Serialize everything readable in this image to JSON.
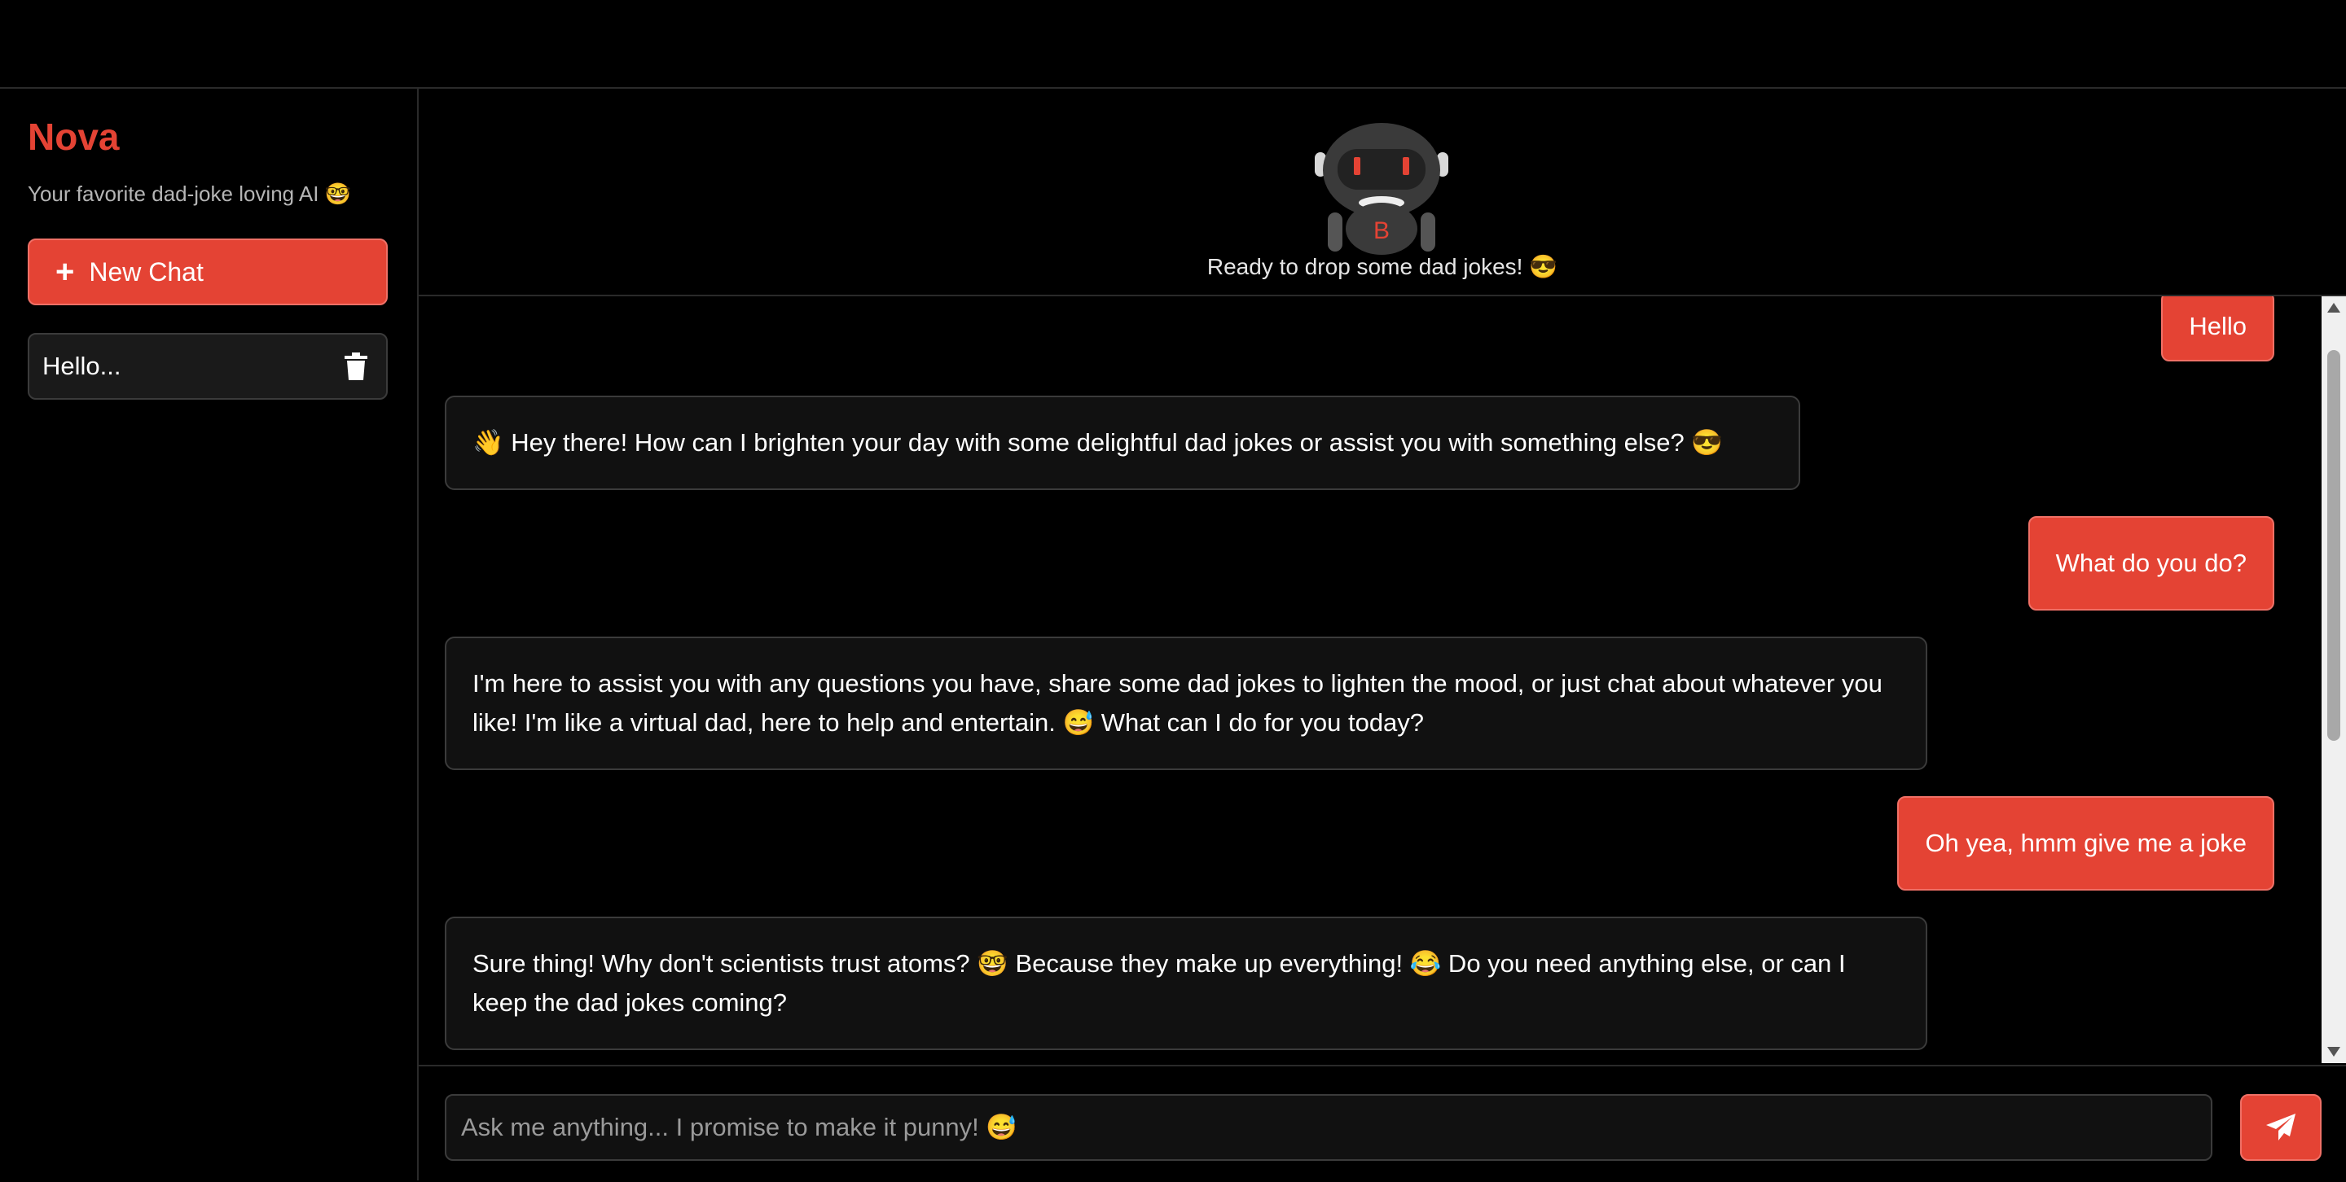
{
  "sidebar": {
    "brand": "Nova",
    "tagline": "Your favorite dad-joke loving AI 🤓",
    "new_chat_label": "New Chat",
    "history": [
      {
        "label": "Hello..."
      }
    ]
  },
  "header": {
    "status": "Ready to drop some dad jokes! 😎",
    "robot_chest_letter": "B"
  },
  "messages": [
    {
      "role": "user",
      "text": "Hello"
    },
    {
      "role": "bot",
      "text": "👋 Hey there! How can I brighten your day with some delightful dad jokes or assist you with something else? 😎"
    },
    {
      "role": "user",
      "text": "What do you do?"
    },
    {
      "role": "bot",
      "text": "I'm here to assist you with any questions you have, share some dad jokes to lighten the mood, or just chat about whatever you like! I'm like a virtual dad, here to help and entertain. 😅 What can I do for you today?"
    },
    {
      "role": "user",
      "text": "Oh yea, hmm give me a joke"
    },
    {
      "role": "bot",
      "text": "Sure thing! Why don't scientists trust atoms? 🤓 Because they make up everything! 😂 Do you need anything else, or can I keep the dad jokes coming?"
    }
  ],
  "composer": {
    "placeholder": "Ask me anything... I promise to make it punny! 😅",
    "value": ""
  },
  "colors": {
    "accent": "#e44334",
    "background": "#000000",
    "panel": "#111111",
    "border": "#3b3b3b"
  },
  "icons": {
    "new_chat": "plus-icon",
    "delete": "trash-icon",
    "send": "paper-plane-icon",
    "avatar": "robot-icon"
  }
}
